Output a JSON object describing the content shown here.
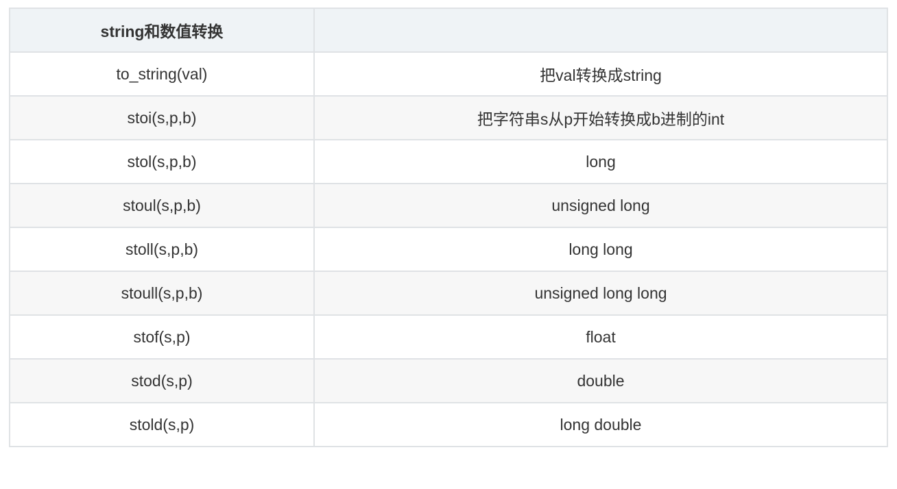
{
  "table": {
    "headers": [
      "string和数值转换",
      ""
    ],
    "rows": [
      [
        "to_string(val)",
        "把val转换成string"
      ],
      [
        "stoi(s,p,b)",
        "把字符串s从p开始转换成b进制的int"
      ],
      [
        "stol(s,p,b)",
        "long"
      ],
      [
        "stoul(s,p,b)",
        "unsigned long"
      ],
      [
        "stoll(s,p,b)",
        "long long"
      ],
      [
        "stoull(s,p,b)",
        "unsigned long long"
      ],
      [
        "stof(s,p)",
        "float"
      ],
      [
        "stod(s,p)",
        "double"
      ],
      [
        "stold(s,p)",
        "long double"
      ]
    ]
  },
  "colors": {
    "border": "#dfe2e5",
    "header_bg": "#eff3f6",
    "row_alt_bg": "#f7f7f7",
    "text": "#333333"
  }
}
